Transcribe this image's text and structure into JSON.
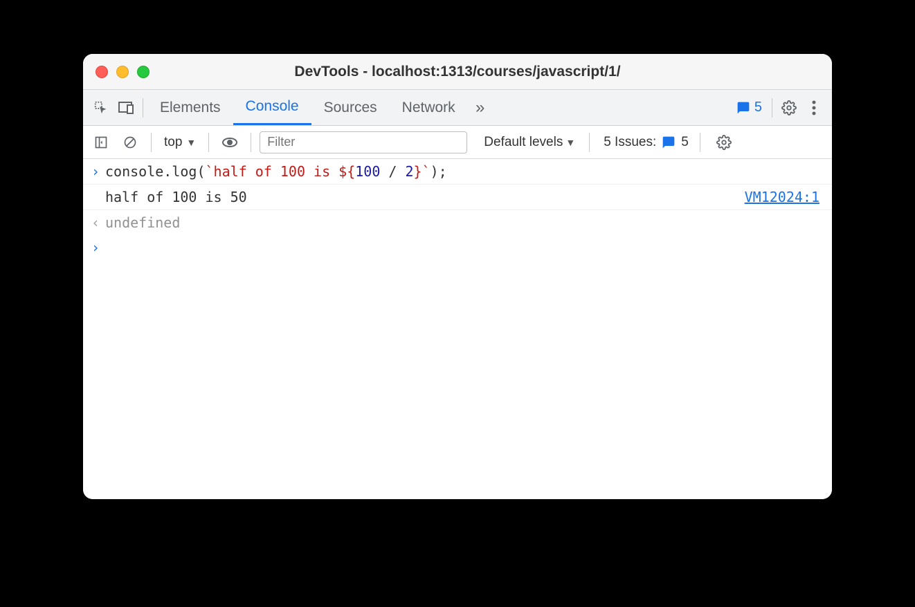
{
  "window": {
    "title": "DevTools - localhost:1313/courses/javascript/1/"
  },
  "tabs": {
    "elements": "Elements",
    "console": "Console",
    "sources": "Sources",
    "network": "Network"
  },
  "header_badge": {
    "count": "5"
  },
  "toolbar": {
    "context": "top",
    "filter_placeholder": "Filter",
    "levels_label": "Default levels",
    "issues_label": "5 Issues:",
    "issues_count": "5"
  },
  "console": {
    "input_prefix": "console.log(",
    "str_open": "`half of 100 is ",
    "expr_open": "${",
    "num1": "100",
    "op": " / ",
    "num2": "2",
    "expr_close": "}",
    "str_close": "`",
    "input_suffix": ");",
    "output_text": "half of 100 is 50",
    "source_link": "VM12024:1",
    "return_value": "undefined"
  }
}
